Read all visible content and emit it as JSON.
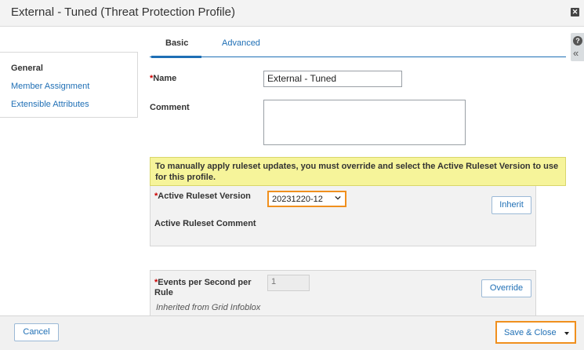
{
  "dialog": {
    "title": "External - Tuned (Threat Protection Profile)"
  },
  "sidebar": {
    "items": [
      {
        "label": "General"
      },
      {
        "label": "Member Assignment"
      },
      {
        "label": "Extensible Attributes"
      }
    ]
  },
  "tabs": [
    {
      "label": "Basic"
    },
    {
      "label": "Advanced"
    }
  ],
  "form": {
    "required_marker": "*",
    "name_label": "Name",
    "name_value": "External - Tuned",
    "comment_label": "Comment",
    "comment_value": "",
    "warning": "To manually apply ruleset updates, you must override and select the Active Ruleset Version to use for this profile.",
    "active_ruleset_label": "Active Ruleset Version",
    "active_ruleset_value": "20231220-12",
    "inherit_label": "Inherit",
    "active_ruleset_comment_label": "Active Ruleset Comment",
    "eps_label": "Events per Second per Rule",
    "eps_value": "1",
    "override_label": "Override",
    "inherited_note": "Inherited from Grid Infoblox"
  },
  "footer": {
    "cancel_label": "Cancel",
    "save_close_label": "Save & Close"
  },
  "colors": {
    "link": "#1f6fb5",
    "highlight": "#f0901e",
    "warning_bg": "#f6f49a",
    "required": "#cc0000"
  },
  "icons": [
    "close-icon",
    "help-icon",
    "collapse-icon",
    "chevron-down-icon",
    "caret-down-icon"
  ]
}
